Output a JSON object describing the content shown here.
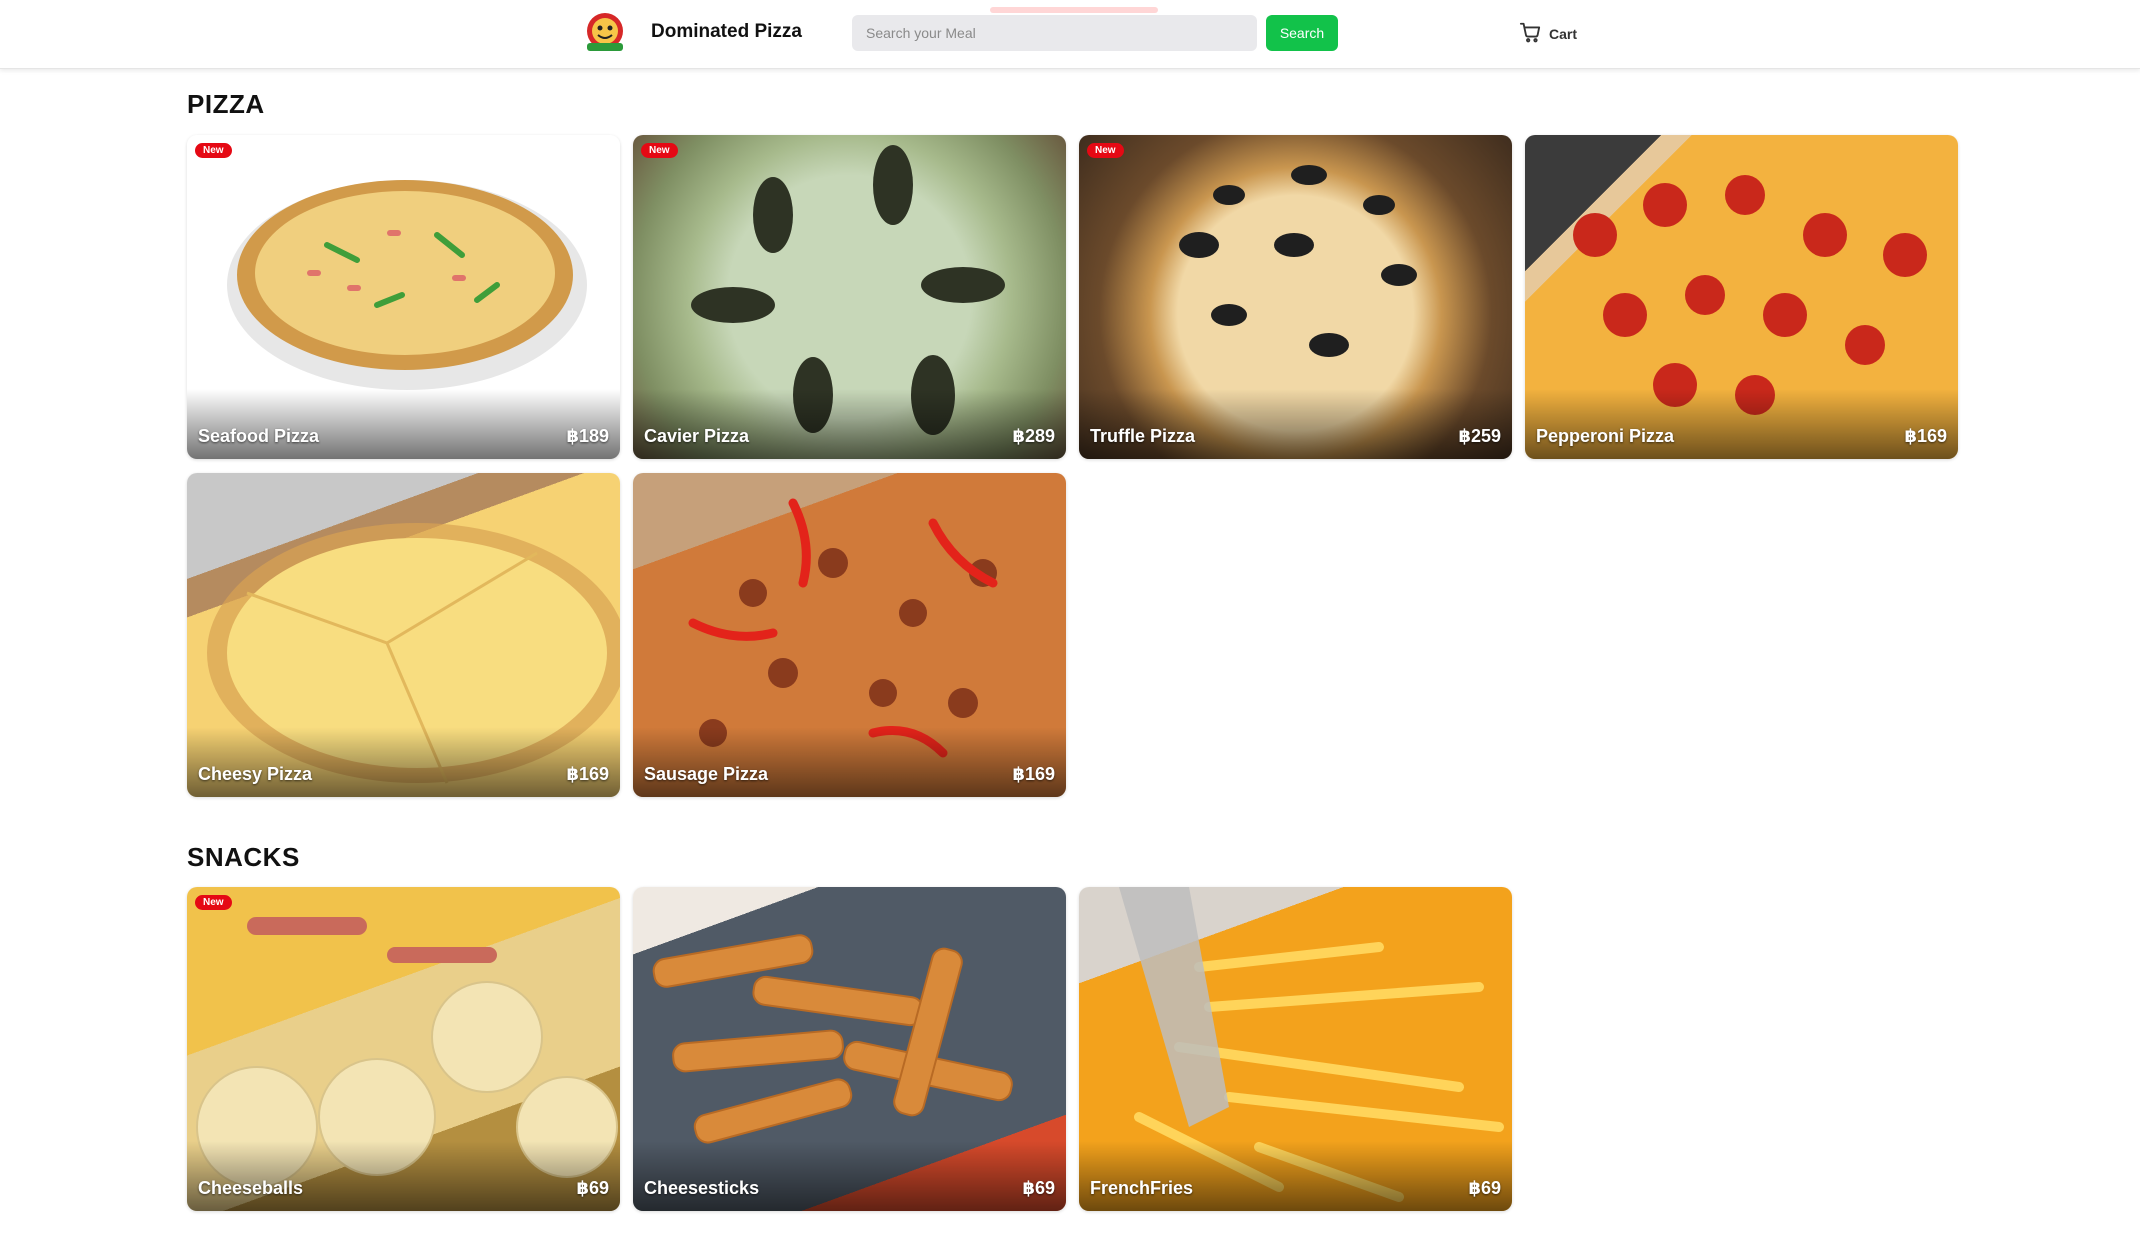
{
  "header": {
    "brand": "Dominated Pizza",
    "search_placeholder": "Search your Meal",
    "search_button": "Search",
    "cart_label": "Cart"
  },
  "sections": [
    {
      "title": "PIZZA",
      "items": [
        {
          "name": "Seafood Pizza",
          "price": "฿189",
          "badge": "New"
        },
        {
          "name": "Cavier Pizza",
          "price": "฿289",
          "badge": "New"
        },
        {
          "name": "Truffle Pizza",
          "price": "฿259",
          "badge": "New"
        },
        {
          "name": "Pepperoni Pizza",
          "price": "฿169",
          "badge": ""
        },
        {
          "name": "Cheesy Pizza",
          "price": "฿169",
          "badge": ""
        },
        {
          "name": "Sausage Pizza",
          "price": "฿169",
          "badge": ""
        }
      ]
    },
    {
      "title": "SNACKS",
      "items": [
        {
          "name": "Cheeseballs",
          "price": "฿69",
          "badge": "New"
        },
        {
          "name": "Cheesesticks",
          "price": "฿69",
          "badge": ""
        },
        {
          "name": "FrenchFries",
          "price": "฿69",
          "badge": ""
        }
      ]
    }
  ],
  "colors": {
    "accent_green": "#12c24a",
    "badge_red": "#e50914"
  },
  "icons": [
    "logo-icon",
    "cart-icon"
  ]
}
